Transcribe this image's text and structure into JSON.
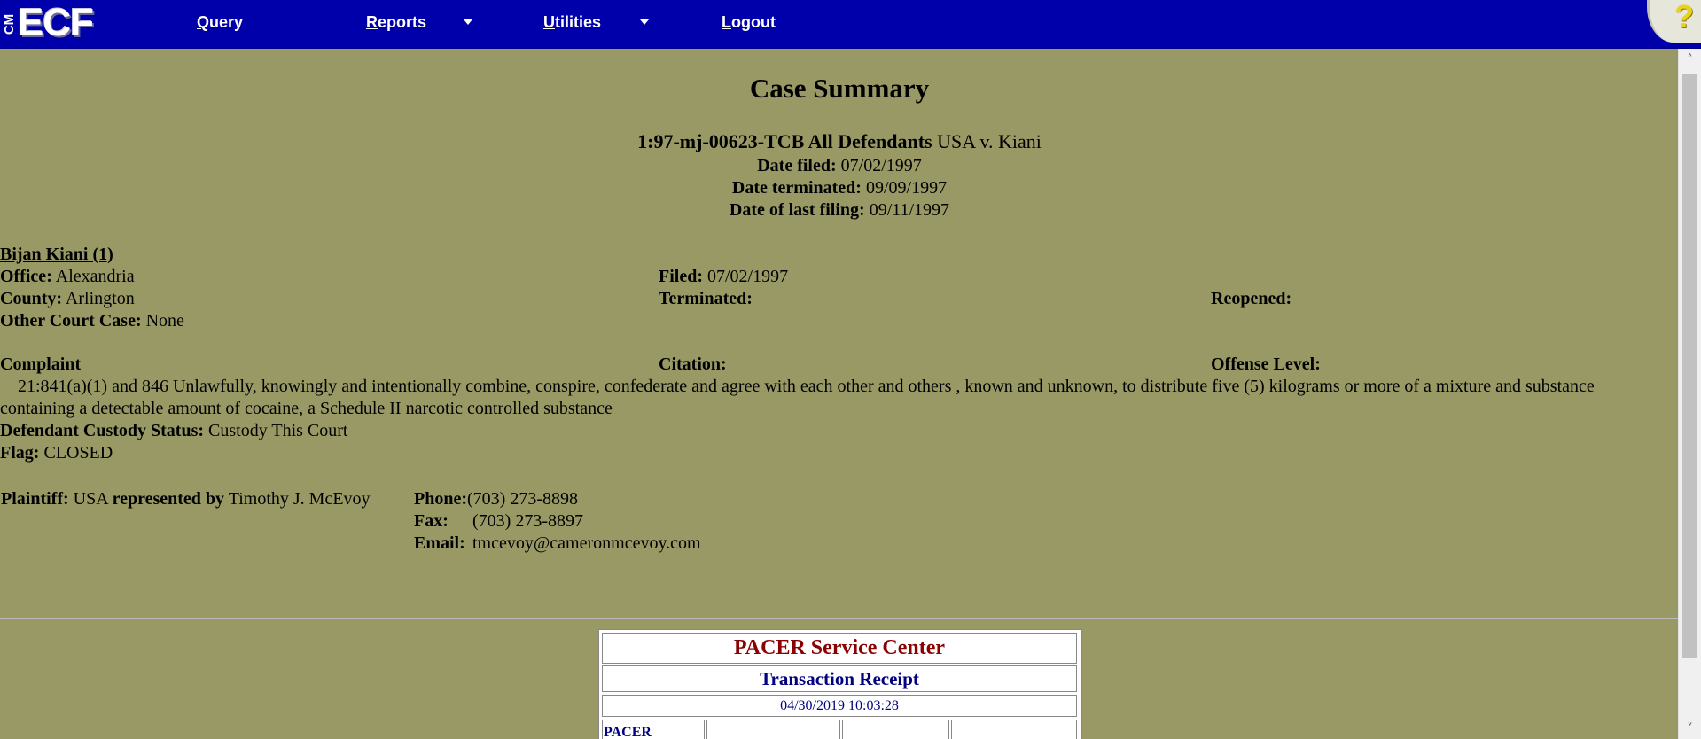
{
  "nav": {
    "logo_small": "CM",
    "logo_big": "ECF",
    "items": [
      {
        "label_first": "Q",
        "label_rest": "uery",
        "has_menu": false
      },
      {
        "label_first": "R",
        "label_rest": "eports",
        "has_menu": true
      },
      {
        "label_first": "U",
        "label_rest": "tilities",
        "has_menu": true
      },
      {
        "label_first": "L",
        "label_rest": "ogout",
        "has_menu": false
      }
    ],
    "help": "?"
  },
  "summary": {
    "title": "Case Summary",
    "case_number": "1:97-mj-00623-TCB All Defendants",
    "case_title": "USA v. Kiani",
    "date_filed_label": "Date filed:",
    "date_filed": "07/02/1997",
    "date_terminated_label": "Date terminated:",
    "date_terminated": "09/09/1997",
    "date_last_filing_label": "Date of last filing:",
    "date_last_filing": "09/11/1997"
  },
  "defendant": {
    "name": "Bijan Kiani (1)",
    "office_label": "Office:",
    "office": "Alexandria",
    "filed_label": "Filed:",
    "filed": "07/02/1997",
    "county_label": "County:",
    "county": "Arlington",
    "terminated_label": "Terminated:",
    "reopened_label": "Reopened:",
    "other_case_label": "Other Court Case:",
    "other_case": "None",
    "complaint_label": "Complaint",
    "citation_label": "Citation:",
    "offense_label": "Offense Level:",
    "charge": "21:841(a)(1) and 846 Unlawfully, knowingly and intentionally combine, conspire, confederate and agree with each other and others , known and unknown, to distribute five (5) kilograms or more of a mixture and substance containing a detectable amount of cocaine, a Schedule II narcotic controlled substance",
    "custody_label": "Defendant Custody Status:",
    "custody": "Custody This Court",
    "flag_label": "Flag:",
    "flag": "CLOSED"
  },
  "plaintiff": {
    "label": "Plaintiff:",
    "name": "USA",
    "represented_label": "represented by",
    "attorney": "Timothy J. McEvoy",
    "phone_label": "Phone:",
    "phone": "(703) 273-8898",
    "fax_label": "Fax:",
    "fax": "(703) 273-8897",
    "email_label": "Email:",
    "email": "tmcevoy@cameronmcevoy.com"
  },
  "receipt": {
    "title": "PACER Service Center",
    "subtitle": "Transaction Receipt",
    "timestamp": "04/30/2019 10:03:28",
    "first_cell": "PACER"
  }
}
